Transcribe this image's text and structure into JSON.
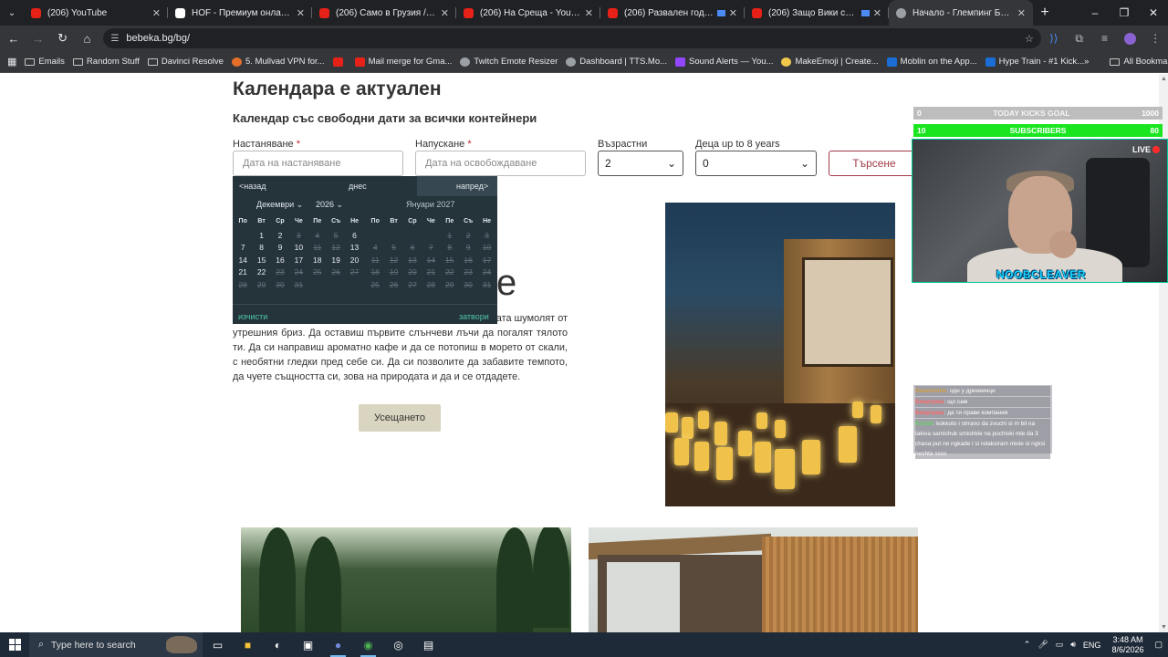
{
  "browser": {
    "tabs": [
      {
        "title": "(206) YouTube",
        "icon": "youtube-icon",
        "active": false,
        "recording": false
      },
      {
        "title": "HOF - Премиум онлайн магазин",
        "icon": "document-icon",
        "active": false,
        "recording": false
      },
      {
        "title": "(206) Само в Грузия / Не бях",
        "icon": "youtube-icon",
        "active": false,
        "recording": false
      },
      {
        "title": "(206) На Среща - YouTube",
        "icon": "youtube-icon",
        "active": false,
        "recording": false
      },
      {
        "title": "(206) Развален годеж, нов",
        "icon": "youtube-icon",
        "active": false,
        "recording": true
      },
      {
        "title": "(206) Защо Вики се РАЗДЕ",
        "icon": "youtube-icon",
        "active": false,
        "recording": true
      },
      {
        "title": "Начало - Глемпинг Бебека",
        "icon": "globe-icon",
        "active": true,
        "recording": false
      }
    ],
    "url": "bebeka.bg/bg/",
    "bookmarks": [
      {
        "label": "Emails",
        "icon": "folder-icon"
      },
      {
        "label": "Random Stuff",
        "icon": "folder-icon"
      },
      {
        "label": "Davinci Resolve",
        "icon": "folder-icon"
      },
      {
        "label": "5. Mullvad VPN for...",
        "icon": "mullvad-icon"
      },
      {
        "label": "",
        "icon": "youtube-icon"
      },
      {
        "label": "Mail merge for Gma...",
        "icon": "mail-merge-icon"
      },
      {
        "label": "Twitch Emote Resizer",
        "icon": "resizer-icon"
      },
      {
        "label": "Dashboard | TTS.Mo...",
        "icon": "dashboard-icon"
      },
      {
        "label": "Sound Alerts — You...",
        "icon": "soundalerts-icon"
      },
      {
        "label": "MakeEmoji | Create...",
        "icon": "makeemoji-icon"
      },
      {
        "label": "Moblin on the App...",
        "icon": "appstore-icon"
      },
      {
        "label": "Hype Train - #1 Kick...",
        "icon": "hypetrain-icon"
      }
    ],
    "all_bookmarks": "All Bookmarks"
  },
  "page": {
    "heading": "Календара е актуален",
    "subheading": "Календар със свободни дати за всички контейнери",
    "form": {
      "checkin_label": "Настаняване",
      "checkin_placeholder": "Дата на настаняване",
      "checkout_label": "Напускане",
      "checkout_placeholder": "Дата на освобождаване",
      "required_mark": "*",
      "adults_label": "Възрастни",
      "adults_value": "2",
      "kids_label": "Деца up to 8 years",
      "kids_value": "0",
      "search_button": "Търсене"
    },
    "datepicker": {
      "prev": "<назад",
      "today": "днес",
      "next": "напред>",
      "month1": "Декември",
      "year1": "2026",
      "month2": "Януари 2027",
      "weekdays": [
        "По",
        "Вт",
        "Ср",
        "Че",
        "Пе",
        "Съ",
        "Не"
      ],
      "month1_days": [
        [
          "",
          "1",
          "2",
          "3",
          "4",
          "5",
          "6"
        ],
        [
          "7",
          "8",
          "9",
          "10",
          "11",
          "12",
          "13"
        ],
        [
          "14",
          "15",
          "16",
          "17",
          "18",
          "19",
          "20"
        ],
        [
          "21",
          "22",
          "23",
          "24",
          "25",
          "26",
          "27"
        ],
        [
          "28",
          "29",
          "30",
          "31",
          "",
          "",
          ""
        ]
      ],
      "month1_disabled": [
        "3",
        "4",
        "5",
        "11",
        "12",
        "23",
        "24",
        "25",
        "26",
        "27",
        "28",
        "29",
        "30",
        "31"
      ],
      "month2_days": [
        [
          "",
          "",
          "",
          "",
          "1",
          "2",
          "3"
        ],
        [
          "4",
          "5",
          "6",
          "7",
          "8",
          "9",
          "10"
        ],
        [
          "11",
          "12",
          "13",
          "14",
          "15",
          "16",
          "17"
        ],
        [
          "18",
          "19",
          "20",
          "21",
          "22",
          "23",
          "24"
        ],
        [
          "25",
          "26",
          "27",
          "28",
          "29",
          "30",
          "31"
        ]
      ],
      "clear": "изчисти",
      "close": "затвори"
    },
    "big_word_fragment": "е",
    "description_lead": "ата шумолят от",
    "description": "утрешния бриз. Да оставиш първите слънчеви лъчи да погалят тялото ти. Да си направиш ароматно кафе и да се потопиш в морето от скали, с необятни гледки пред себе си. Да си позволите да забавите темпото, да чуете същността си, зова на природата и да и се отдадете.",
    "feel_button": "Усещането"
  },
  "stream_overlay": {
    "kicks_goal": {
      "left": "0",
      "label": "TODAY KICKS GOAL",
      "right": "1000"
    },
    "subscribers": {
      "left": "10",
      "label": "SUBSCRIBERS",
      "right": "80"
    },
    "live": "LIVE",
    "nickname": "NOOBCLEAVER",
    "chat": [
      {
        "user": "Dunmonno",
        "text": ": одн у дринкинци",
        "color": "u1"
      },
      {
        "user": "Беергреш",
        "text": ": що сам",
        "color": "u2"
      },
      {
        "user": "Беергреш",
        "text": ": да ти прави компания",
        "color": "u2"
      },
      {
        "user": "Kcltall",
        "text": ": kokkoto i strrano da zvuchi si m bil na takiva samichuk smiohkle na pochivki mle da 3 chasa put ne ngkade i si relaksiram misle si ngksi neshta ssss",
        "color": "u3"
      }
    ]
  },
  "taskbar": {
    "search_placeholder": "Type here to search",
    "lang": "ENG",
    "time": "3:48 AM",
    "date": "8/6/2026"
  }
}
